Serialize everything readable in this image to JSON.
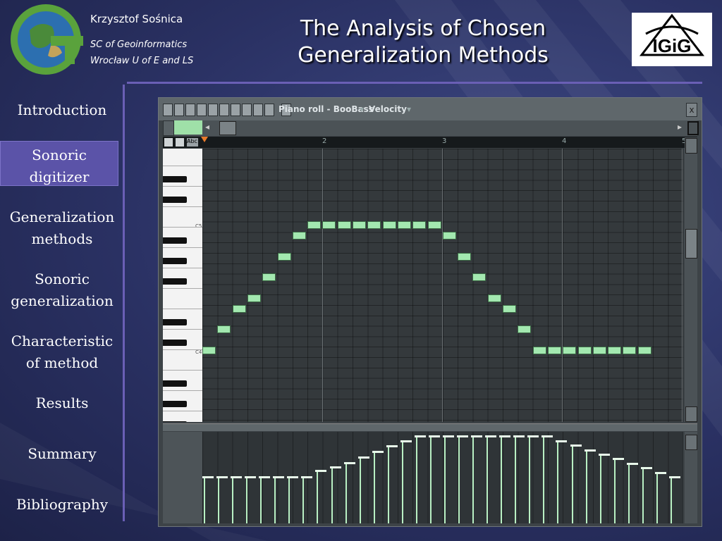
{
  "header": {
    "author": "Krzysztof Sośnica",
    "affiliation_line1": "SC of Geoinformatics",
    "affiliation_line2": "Wrocław U of E and LS",
    "title_line1": "The Analysis of Chosen",
    "title_line2": "Generalization Methods",
    "right_logo_text": "IGiG"
  },
  "nav": [
    {
      "line1": "Introduction",
      "line2": ""
    },
    {
      "line1": "Sonoric",
      "line2": "digitizer",
      "active": true
    },
    {
      "line1": "Generalization",
      "line2": "methods"
    },
    {
      "line1": "Sonoric",
      "line2": "generalization"
    },
    {
      "line1": "Characteristic",
      "line2": "of  method"
    },
    {
      "line1": "Results",
      "line2": ""
    },
    {
      "line1": "Summary",
      "line2": ""
    },
    {
      "line1": "Bibliography",
      "line2": ""
    }
  ],
  "app": {
    "window_title": "Piano roll - BooBass",
    "mode_label": "Velocity",
    "close_label": "x",
    "ruler_labels": [
      "2",
      "3",
      "4",
      "5"
    ],
    "key_labels": [
      "C5",
      "C4"
    ]
  },
  "notes": [
    0,
    2,
    4,
    5,
    7,
    9,
    11,
    12,
    12,
    12,
    12,
    12,
    12,
    12,
    12,
    12,
    11,
    9,
    7,
    5,
    4,
    2,
    0,
    0,
    0,
    0,
    0,
    0,
    0,
    0
  ],
  "velocities": [
    0.5,
    0.5,
    0.5,
    0.5,
    0.5,
    0.5,
    0.5,
    0.5,
    0.57,
    0.61,
    0.66,
    0.72,
    0.78,
    0.84,
    0.9,
    0.95,
    0.95,
    0.95,
    0.95,
    0.95,
    0.95,
    0.95,
    0.95,
    0.95,
    0.95,
    0.9,
    0.85,
    0.8,
    0.75,
    0.7,
    0.65,
    0.6,
    0.55,
    0.5
  ],
  "colors": {
    "accent": "#6a5fb5",
    "note": "#a3e8b0"
  }
}
